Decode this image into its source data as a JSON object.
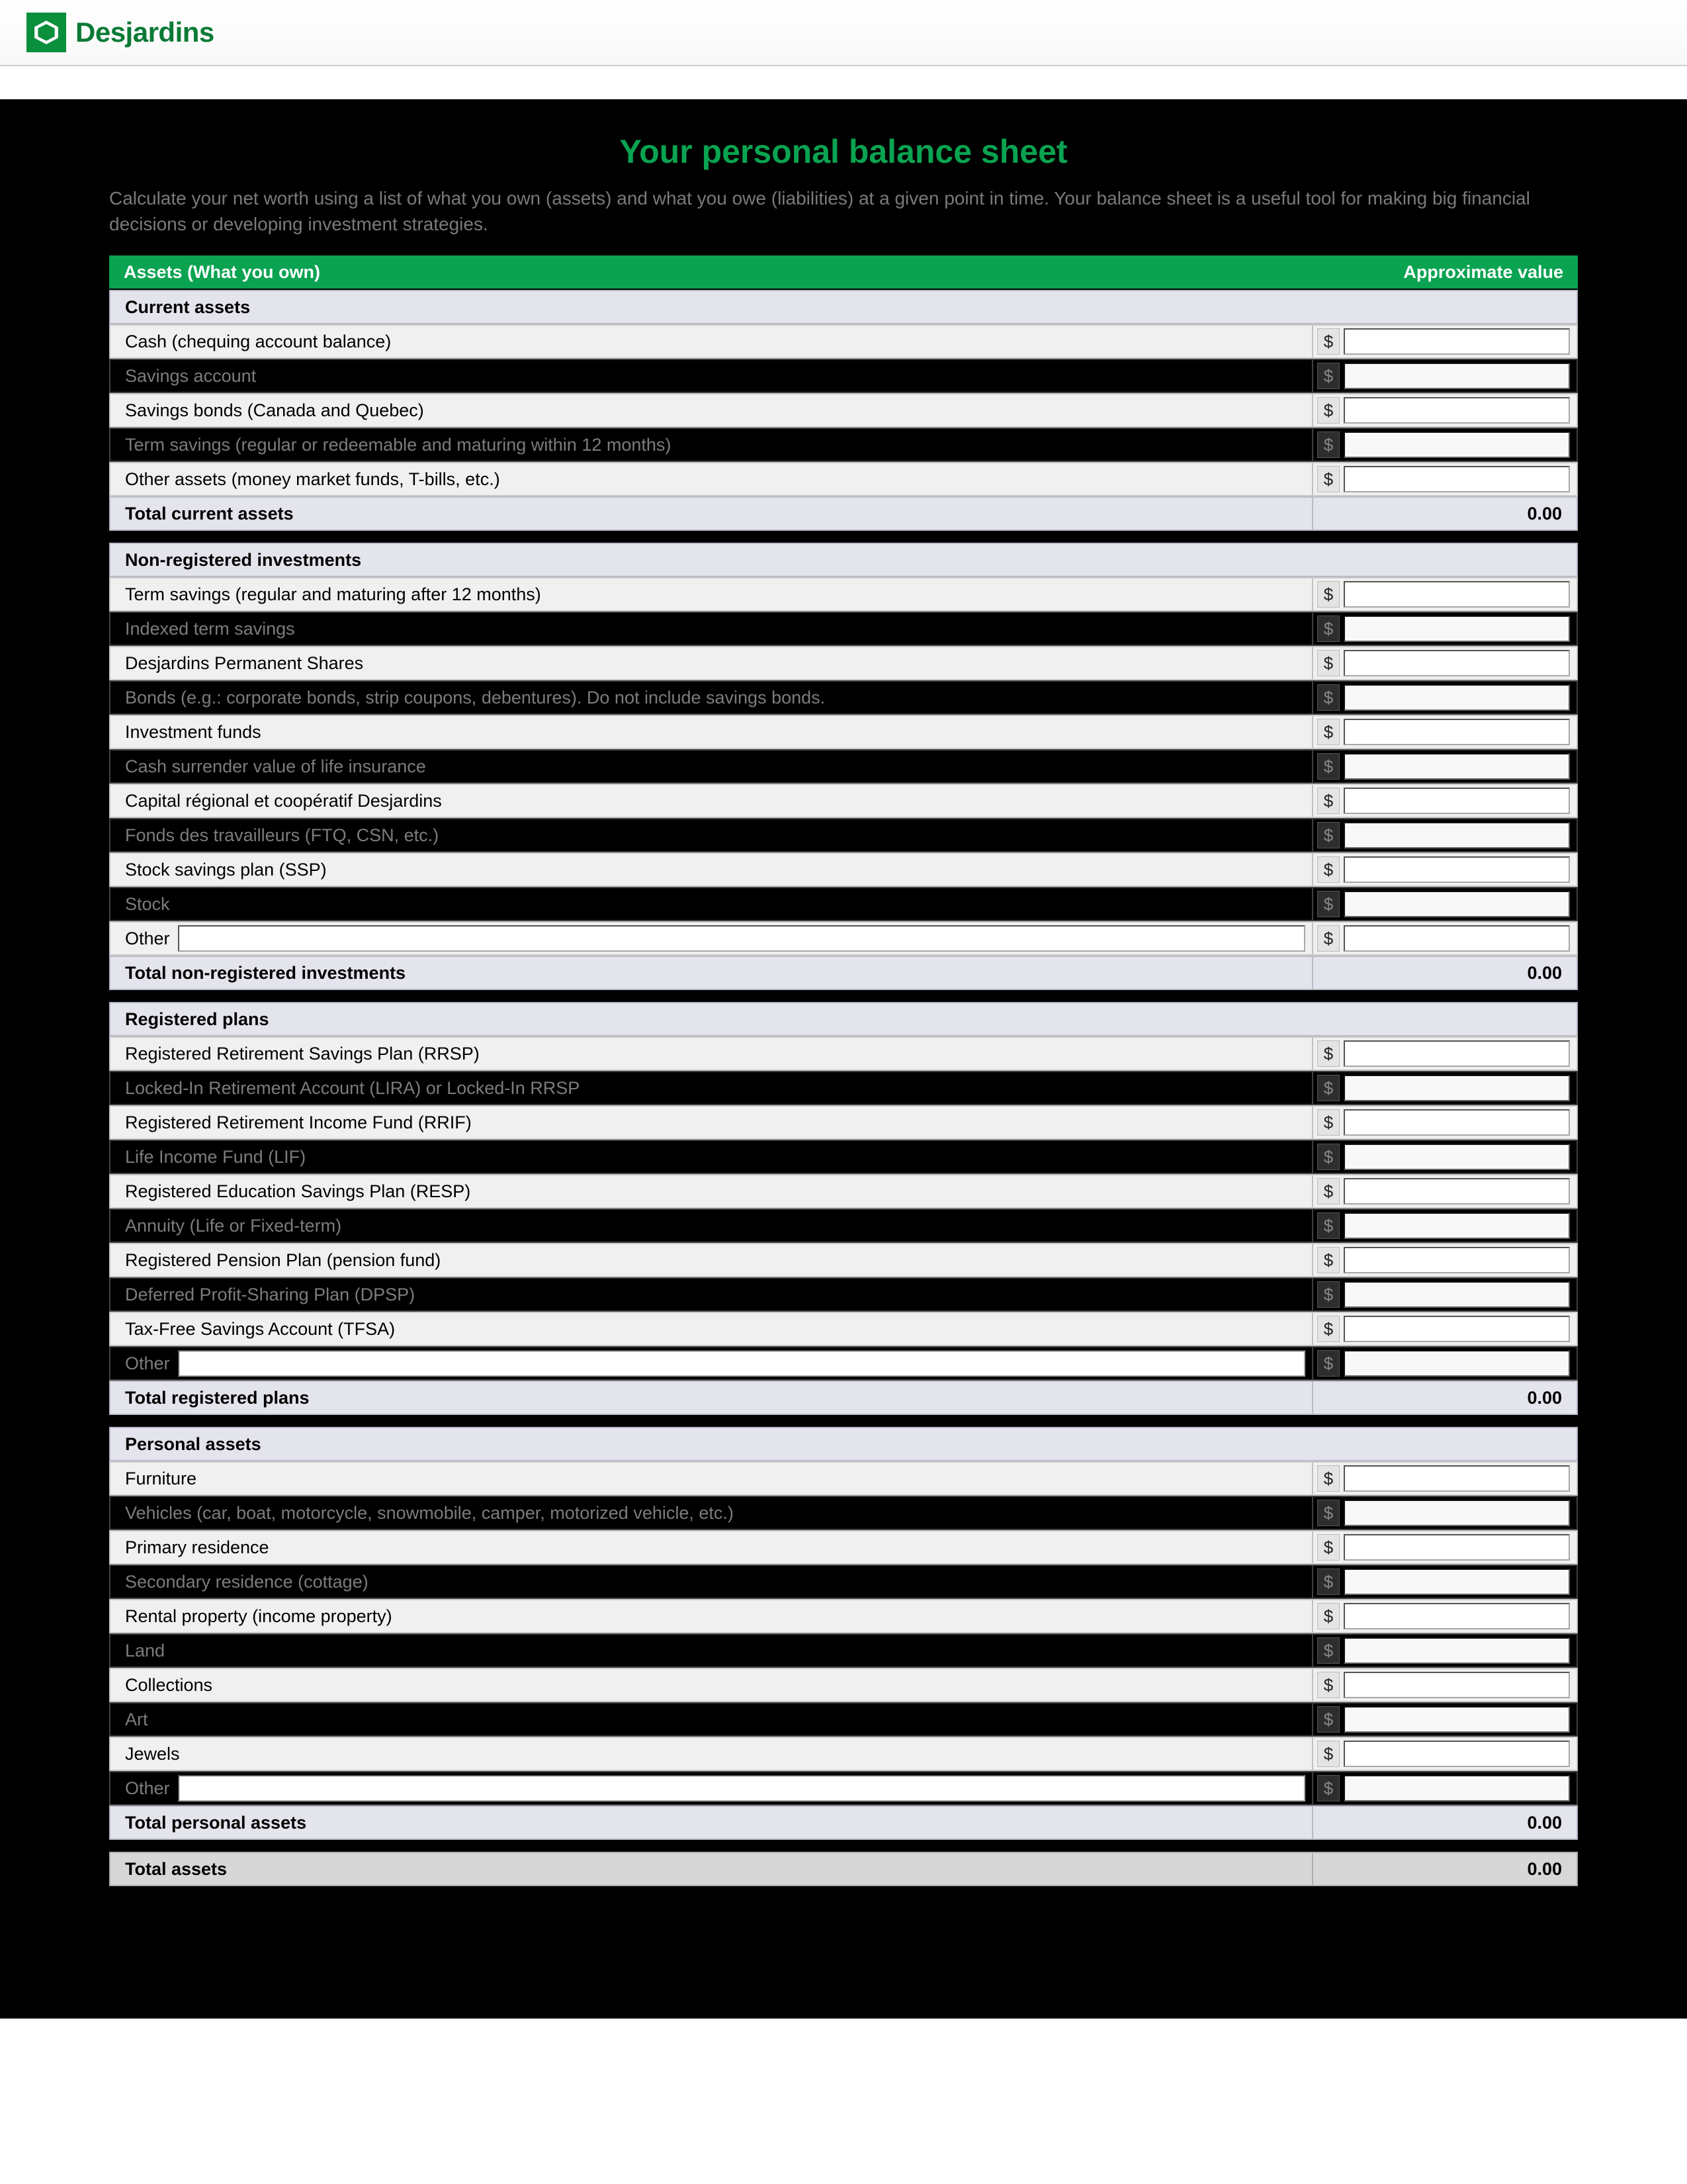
{
  "brand": "Desjardins",
  "title": "Your personal balance sheet",
  "intro": "Calculate your net worth using a list of what you own (assets) and what you owe (liabilities) at a given point in time. Your balance sheet is a useful tool for making big financial decisions or developing investment strategies.",
  "assets_header": {
    "label": "Assets (What you own)",
    "value_label": "Approximate value"
  },
  "currency_symbol": "$",
  "sections": {
    "current": {
      "header": "Current assets",
      "rows": [
        "Cash (chequing account balance)",
        "Savings account",
        "Savings bonds (Canada and Quebec)",
        "Term savings (regular or redeemable and maturing within 12 months)",
        "Other assets (money market funds, T-bills, etc.)"
      ],
      "total_label": "Total current assets",
      "total_value": "0.00"
    },
    "nonreg": {
      "header": "Non-registered investments",
      "rows": [
        "Term savings (regular and maturing after 12 months)",
        "Indexed term savings",
        "Desjardins Permanent Shares",
        "Bonds (e.g.: corporate bonds, strip coupons, debentures). Do not include savings bonds.",
        "Investment funds",
        "Cash surrender value of life insurance",
        "Capital régional et coopératif Desjardins",
        "Fonds des travailleurs (FTQ, CSN, etc.)",
        "Stock savings plan (SSP)",
        "Stock"
      ],
      "other_label": "Other",
      "total_label": "Total non-registered investments",
      "total_value": "0.00"
    },
    "registered": {
      "header": "Registered plans",
      "rows": [
        "Registered Retirement Savings Plan (RRSP)",
        "Locked-In Retirement Account (LIRA) or Locked-In RRSP",
        "Registered Retirement Income Fund (RRIF)",
        "Life Income Fund (LIF)",
        "Registered Education Savings Plan (RESP)",
        "Annuity (Life or Fixed-term)",
        "Registered Pension Plan (pension fund)",
        "Deferred Profit-Sharing Plan (DPSP)",
        "Tax-Free Savings Account (TFSA)"
      ],
      "other_label": "Other",
      "total_label": "Total registered plans",
      "total_value": "0.00"
    },
    "personal": {
      "header": "Personal assets",
      "rows": [
        "Furniture",
        "Vehicles (car, boat, motorcycle, snowmobile, camper, motorized vehicle, etc.)",
        "Primary residence",
        "Secondary residence (cottage)",
        "Rental property (income property)",
        "Land",
        "Collections",
        "Art",
        "Jewels"
      ],
      "other_label": "Other",
      "total_label": "Total personal assets",
      "total_value": "0.00"
    }
  },
  "grand_total": {
    "label": "Total assets",
    "value": "0.00"
  }
}
